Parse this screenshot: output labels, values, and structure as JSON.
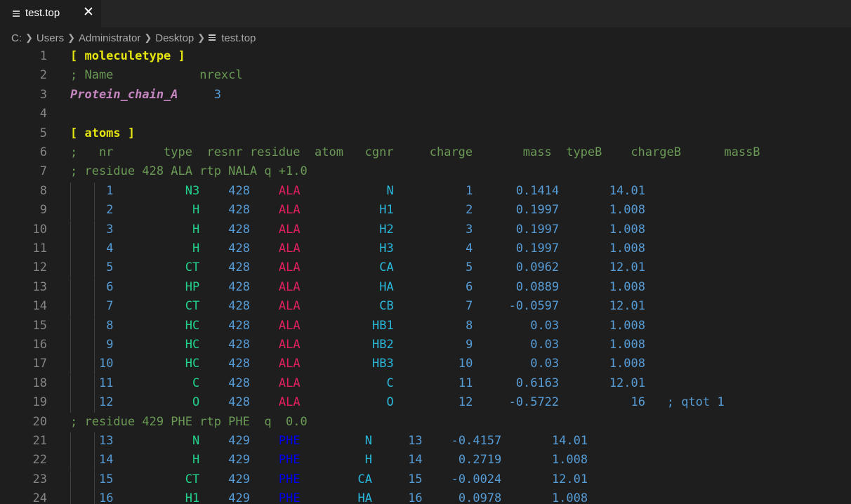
{
  "tab": {
    "title": "test.top",
    "icon": "file-lines-icon",
    "close_label": "✕"
  },
  "breadcrumb": {
    "segments": [
      "C:",
      "Users",
      "Administrator",
      "Desktop"
    ],
    "file": "test.top"
  },
  "colors": {
    "background": "#1e1e1e",
    "line_number": "#858585",
    "comment": "#6a9955",
    "section": "#e5e510",
    "molecule_name": "#c586c0",
    "number": "#569cd6",
    "atom_type": "#23d18b",
    "atom_name": "#29b8db",
    "residue_ala": "#e4205f",
    "residue_phe": "#0000ee"
  },
  "lines": [
    {
      "n": "1",
      "text": "[ moleculetype ]",
      "kind": "section"
    },
    {
      "n": "2",
      "text": "; Name            nrexcl",
      "kind": "comment"
    },
    {
      "n": "3",
      "text": "Protein_chain_A     3",
      "kind": "molecule"
    },
    {
      "n": "4",
      "text": "",
      "kind": "blank"
    },
    {
      "n": "5",
      "text": "[ atoms ]",
      "kind": "section"
    },
    {
      "n": "6",
      "text": ";   nr       type  resnr residue  atom   cgnr     charge       mass  typeB    chargeB      massB",
      "kind": "comment"
    },
    {
      "n": "7",
      "text": "; residue 428 ALA rtp NALA q +1.0",
      "kind": "comment"
    },
    {
      "n": "8",
      "nr": "1",
      "type": "N3",
      "resnr": "428",
      "res": "ALA",
      "atom": "N",
      "cgnr": "1",
      "charge": "0.1414",
      "mass": "14.01",
      "kind": "ala"
    },
    {
      "n": "9",
      "nr": "2",
      "type": "H",
      "resnr": "428",
      "res": "ALA",
      "atom": "H1",
      "cgnr": "2",
      "charge": "0.1997",
      "mass": "1.008",
      "kind": "ala"
    },
    {
      "n": "10",
      "nr": "3",
      "type": "H",
      "resnr": "428",
      "res": "ALA",
      "atom": "H2",
      "cgnr": "3",
      "charge": "0.1997",
      "mass": "1.008",
      "kind": "ala"
    },
    {
      "n": "11",
      "nr": "4",
      "type": "H",
      "resnr": "428",
      "res": "ALA",
      "atom": "H3",
      "cgnr": "4",
      "charge": "0.1997",
      "mass": "1.008",
      "kind": "ala"
    },
    {
      "n": "12",
      "nr": "5",
      "type": "CT",
      "resnr": "428",
      "res": "ALA",
      "atom": "CA",
      "cgnr": "5",
      "charge": "0.0962",
      "mass": "12.01",
      "kind": "ala"
    },
    {
      "n": "13",
      "nr": "6",
      "type": "HP",
      "resnr": "428",
      "res": "ALA",
      "atom": "HA",
      "cgnr": "6",
      "charge": "0.0889",
      "mass": "1.008",
      "kind": "ala"
    },
    {
      "n": "14",
      "nr": "7",
      "type": "CT",
      "resnr": "428",
      "res": "ALA",
      "atom": "CB",
      "cgnr": "7",
      "charge": "-0.0597",
      "mass": "12.01",
      "kind": "ala"
    },
    {
      "n": "15",
      "nr": "8",
      "type": "HC",
      "resnr": "428",
      "res": "ALA",
      "atom": "HB1",
      "cgnr": "8",
      "charge": "0.03",
      "mass": "1.008",
      "kind": "ala"
    },
    {
      "n": "16",
      "nr": "9",
      "type": "HC",
      "resnr": "428",
      "res": "ALA",
      "atom": "HB2",
      "cgnr": "9",
      "charge": "0.03",
      "mass": "1.008",
      "kind": "ala"
    },
    {
      "n": "17",
      "nr": "10",
      "type": "HC",
      "resnr": "428",
      "res": "ALA",
      "atom": "HB3",
      "cgnr": "10",
      "charge": "0.03",
      "mass": "1.008",
      "kind": "ala"
    },
    {
      "n": "18",
      "nr": "11",
      "type": "C",
      "resnr": "428",
      "res": "ALA",
      "atom": "C",
      "cgnr": "11",
      "charge": "0.6163",
      "mass": "12.01",
      "kind": "ala"
    },
    {
      "n": "19",
      "nr": "12",
      "type": "O",
      "resnr": "428",
      "res": "ALA",
      "atom": "O",
      "cgnr": "12",
      "charge": "-0.5722",
      "mass": "16",
      "tail": "; qtot 1",
      "kind": "ala"
    },
    {
      "n": "20",
      "text": "; residue 429 PHE rtp PHE  q  0.0",
      "kind": "comment"
    },
    {
      "n": "21",
      "nr": "13",
      "type": "N",
      "resnr": "429",
      "res": "PHE",
      "atom": "N",
      "cgnr": "13",
      "charge": "-0.4157",
      "mass": "14.01",
      "kind": "phe"
    },
    {
      "n": "22",
      "nr": "14",
      "type": "H",
      "resnr": "429",
      "res": "PHE",
      "atom": "H",
      "cgnr": "14",
      "charge": "0.2719",
      "mass": "1.008",
      "kind": "phe"
    },
    {
      "n": "23",
      "nr": "15",
      "type": "CT",
      "resnr": "429",
      "res": "PHE",
      "atom": "CA",
      "cgnr": "15",
      "charge": "-0.0024",
      "mass": "12.01",
      "kind": "phe"
    },
    {
      "n": "24",
      "nr": "16",
      "type": "H1",
      "resnr": "429",
      "res": "PHE",
      "atom": "HA",
      "cgnr": "16",
      "charge": "0.0978",
      "mass": "1.008",
      "kind": "phe"
    }
  ]
}
